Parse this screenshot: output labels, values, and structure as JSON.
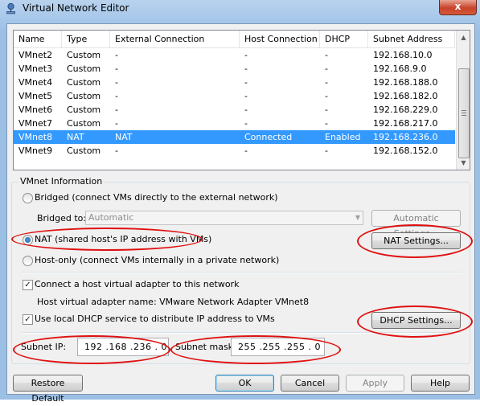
{
  "window": {
    "title": "Virtual Network Editor",
    "close_glyph": "x"
  },
  "list": {
    "columns": [
      "Name",
      "Type",
      "External Connection",
      "Host Connection",
      "DHCP",
      "Subnet Address"
    ],
    "rows": [
      [
        "VMnet2",
        "Custom",
        "-",
        "-",
        "-",
        "192.168.10.0"
      ],
      [
        "VMnet3",
        "Custom",
        "-",
        "-",
        "-",
        "192.168.9.0"
      ],
      [
        "VMnet4",
        "Custom",
        "-",
        "-",
        "-",
        "192.168.188.0"
      ],
      [
        "VMnet5",
        "Custom",
        "-",
        "-",
        "-",
        "192.168.182.0"
      ],
      [
        "VMnet6",
        "Custom",
        "-",
        "-",
        "-",
        "192.168.229.0"
      ],
      [
        "VMnet7",
        "Custom",
        "-",
        "-",
        "-",
        "192.168.217.0"
      ],
      [
        "VMnet8",
        "NAT",
        "NAT",
        "Connected",
        "Enabled",
        "192.168.236.0"
      ],
      [
        "VMnet9",
        "Custom",
        "-",
        "-",
        "-",
        "192.168.152.0"
      ]
    ],
    "selected_row": 6
  },
  "vmnet_info": {
    "legend": "VMnet Information",
    "bridged_label": "Bridged (connect VMs directly to the external network)",
    "bridged_to_label": "Bridged to:",
    "bridged_to_value": "Automatic",
    "automatic_settings_label": "Automatic Settings...",
    "nat_label": "NAT (shared host's IP address with VMs)",
    "nat_settings_label": "NAT Settings...",
    "hostonly_label": "Host-only (connect VMs internally in a private network)",
    "connect_adapter_label": "Connect a host virtual adapter to this network",
    "adapter_name_text": "Host virtual adapter name: VMware Network Adapter VMnet8",
    "dhcp_label": "Use local DHCP service to distribute IP address to VMs",
    "dhcp_settings_label": "DHCP Settings...",
    "subnet_ip_label": "Subnet IP:",
    "subnet_ip_value": "192 .168 .236 . 0",
    "subnet_mask_label": "Subnet mask:",
    "subnet_mask_value": "255 .255 .255 . 0",
    "selected_mode": "nat",
    "connect_adapter_checked": true,
    "dhcp_checked": true
  },
  "footer": {
    "restore_label": "Restore Default",
    "ok_label": "OK",
    "cancel_label": "Cancel",
    "apply_label": "Apply",
    "help_label": "Help"
  },
  "annotation_color": "#e01010",
  "selection_color": "#3399ff"
}
